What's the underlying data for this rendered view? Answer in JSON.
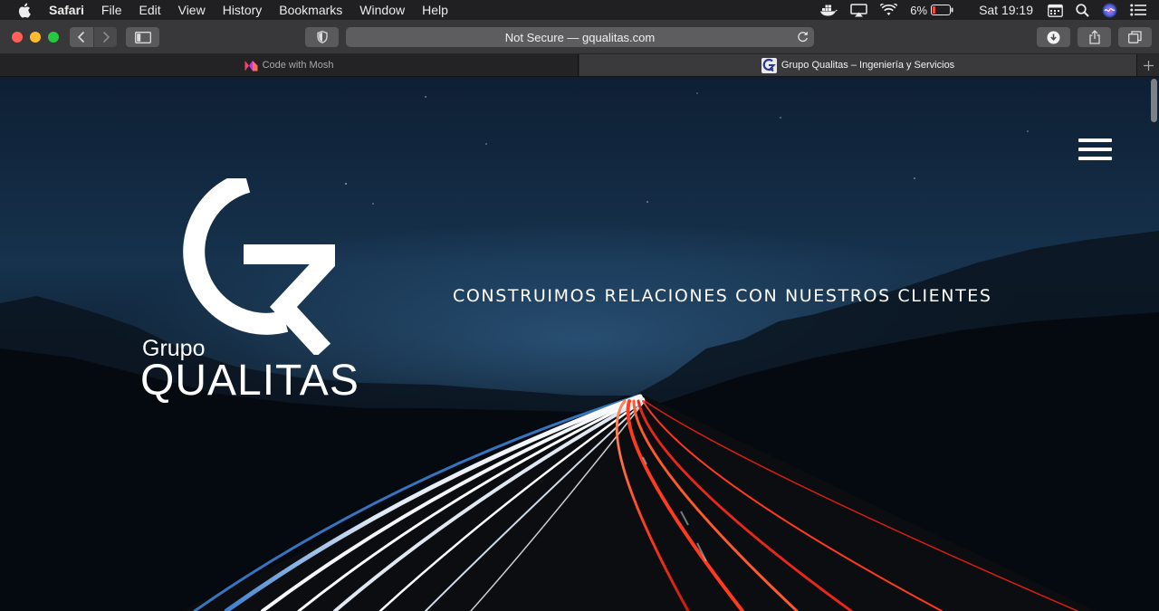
{
  "menubar": {
    "app_name": "Safari",
    "items": [
      "File",
      "Edit",
      "View",
      "History",
      "Bookmarks",
      "Window",
      "Help"
    ],
    "battery_percent": "6%",
    "clock": "Sat 19:19"
  },
  "toolbar": {
    "address_text": "Not Secure — gqualitas.com"
  },
  "tabs": [
    {
      "title": "Code with Mosh",
      "active": false
    },
    {
      "title": "Grupo Qualitas – Ingeniería y Servicios",
      "active": true
    }
  ],
  "page": {
    "logo": {
      "small": "Grupo",
      "large": "QUALITAS"
    },
    "tagline": "CONSTRUIMOS RELACIONES CON NUESTROS CLIENTES"
  },
  "colors": {
    "traffic_red": "#fe5f57",
    "traffic_yellow": "#febc2e",
    "traffic_green": "#28c840",
    "battery_low": "#ff453a",
    "light_trail_red": "#ff3b1f",
    "light_trail_white": "#ffffff",
    "light_trail_blue": "#4a8fd8"
  }
}
